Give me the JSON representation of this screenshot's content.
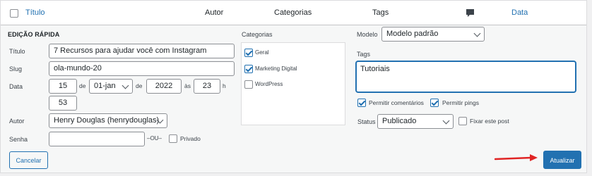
{
  "table_header": {
    "title": "Título",
    "author": "Autor",
    "categories": "Categorias",
    "tags": "Tags",
    "comments_icon": "comment-bubble-icon",
    "date": "Data"
  },
  "quick_edit": {
    "legend": "Edição rápida",
    "title_label": "Título",
    "title_value": "7 Recursos para ajudar você com Instagram",
    "slug_label": "Slug",
    "slug_value": "ola-mundo-20",
    "date_label": "Data",
    "day": "15",
    "de1": "de",
    "month": "01-jan",
    "de2": "de",
    "year": "2022",
    "as": "às",
    "hour": "23",
    "h": "h",
    "minute": "53",
    "author_label": "Autor",
    "author_value": "Henry Douglas (henrydouglas)",
    "password_label": "Senha",
    "password_value": "",
    "or": "–OU–",
    "private_label": "Privado",
    "categories_label": "Categorias",
    "categories": [
      {
        "label": "Geral",
        "checked": true
      },
      {
        "label": "Marketing Digital",
        "checked": true
      },
      {
        "label": "WordPress",
        "checked": false
      }
    ],
    "template_label": "Modelo",
    "template_value": "Modelo padrão",
    "tags_label": "Tags",
    "tags_value": "Tutoriais",
    "allow_comments": "Permitir comentários",
    "allow_pings": "Permitir pings",
    "status_label": "Status",
    "status_value": "Publicado",
    "sticky_label": "Fixar este post",
    "cancel": "Cancelar",
    "update": "Atualizar"
  },
  "colors": {
    "accent": "#2271b1",
    "arrow": "#e02424"
  }
}
